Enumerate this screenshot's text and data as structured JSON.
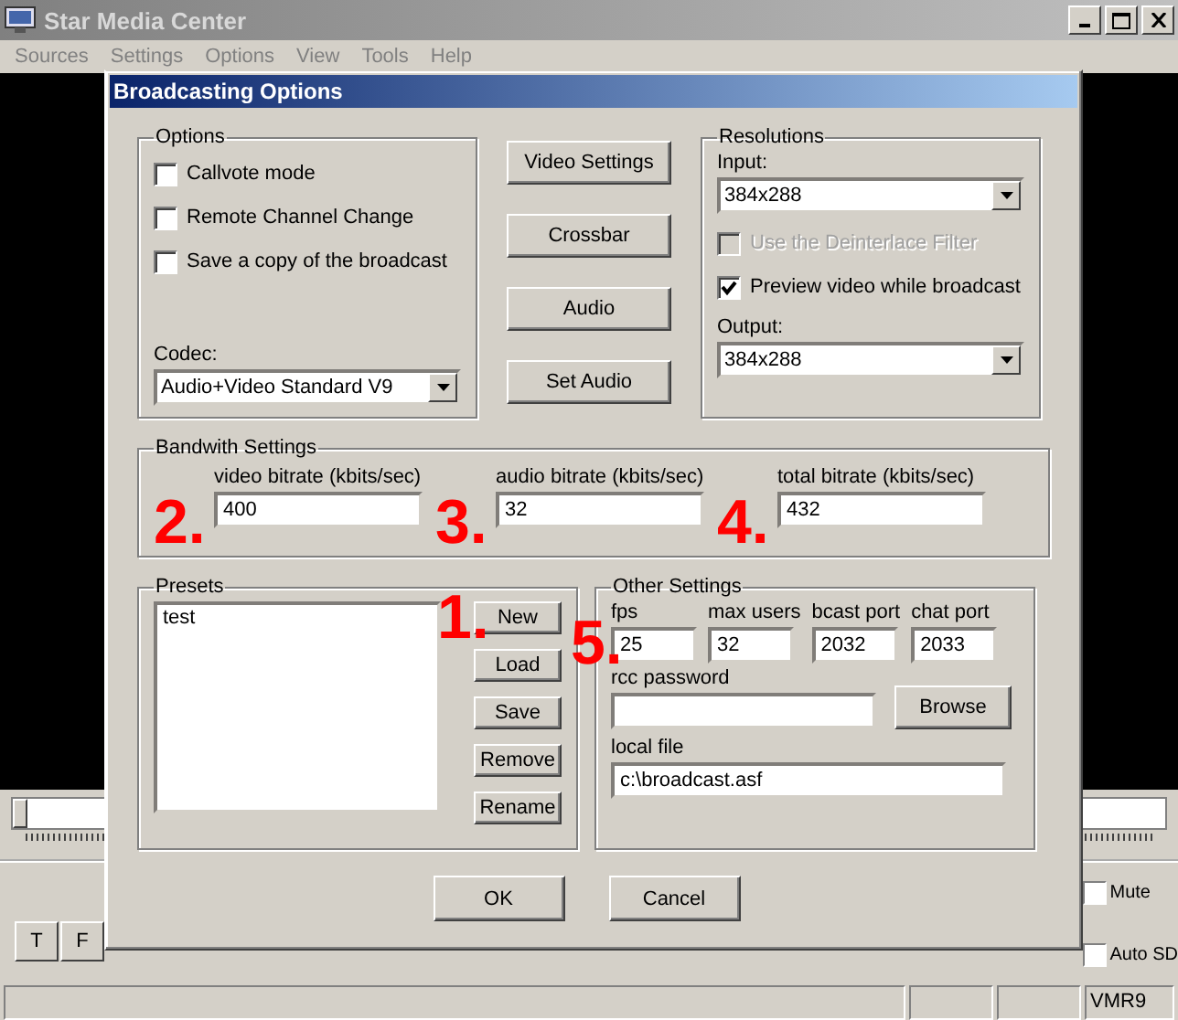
{
  "window": {
    "title": "Star Media Center"
  },
  "menu": [
    {
      "label": "Sources",
      "disabled": true
    },
    {
      "label": "Settings",
      "disabled": true
    },
    {
      "label": "Options",
      "disabled": true
    },
    {
      "label": "View",
      "disabled": true
    },
    {
      "label": "Tools",
      "disabled": true
    },
    {
      "label": "Help",
      "disabled": true
    }
  ],
  "player_buttons": [
    "T",
    "F"
  ],
  "player_checks": [
    {
      "label": "Mute",
      "checked": false
    },
    {
      "label": "Auto SD",
      "checked": false
    }
  ],
  "seek": {
    "level": 0
  },
  "status_bar": {
    "renderer": "VMR9"
  },
  "dialog": {
    "title": "Broadcasting Options",
    "options": {
      "title": "Options",
      "checkboxes": [
        {
          "label": "Callvote mode",
          "checked": false
        },
        {
          "label": "Remote Channel Change",
          "checked": false
        },
        {
          "label": "Save a copy of the broadcast",
          "checked": false
        }
      ],
      "codec_label": "Codec:",
      "codec": "Audio+Video Standard V9"
    },
    "action_buttons": [
      "Video Settings",
      "Crossbar",
      "Audio",
      "Set Audio"
    ],
    "resolutions": {
      "title": "Resolutions",
      "input_label": "Input:",
      "input": "384x288",
      "checkboxes": [
        {
          "label": "Use the Deinterlace Filter",
          "checked": false,
          "disabled": true
        },
        {
          "label": "Preview video while broadcast",
          "checked": true,
          "disabled": false
        }
      ],
      "output_label": "Output:",
      "output": "384x288"
    },
    "bandwidth": {
      "title": "Bandwith Settings",
      "fields": [
        {
          "label": "video bitrate (kbits/sec)",
          "value": "400",
          "marker": "2."
        },
        {
          "label": "audio bitrate (kbits/sec)",
          "value": "32",
          "marker": "3."
        },
        {
          "label": "total bitrate (kbits/sec)",
          "value": "432",
          "marker": "4."
        }
      ]
    },
    "presets": {
      "title": "Presets",
      "items": [
        {
          "label": "test",
          "selected": false
        }
      ],
      "buttons": [
        "New",
        "Load",
        "Save",
        "Remove",
        "Rename"
      ],
      "marker": "1."
    },
    "other": {
      "title": "Other Settings",
      "fields": [
        {
          "label": "fps",
          "value": "25",
          "marker": "5."
        },
        {
          "label": "max users",
          "value": "32"
        },
        {
          "label": "bcast port",
          "value": "2032"
        },
        {
          "label": "chat port",
          "value": "2033"
        }
      ],
      "password_label": "rcc password",
      "browse": "Browse",
      "local_file_label": "local file",
      "local_file": "c:\\broadcast.asf"
    },
    "buttons": [
      "OK",
      "Cancel"
    ]
  }
}
